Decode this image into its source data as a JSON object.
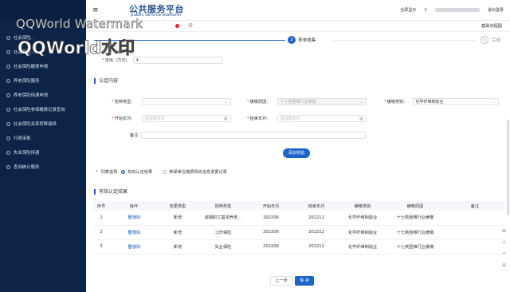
{
  "header": {
    "title": "公共服务平台",
    "subtitle": "public service platform",
    "links": [
      "全屏显示",
      "退出登录"
    ]
  },
  "tabbar": {
    "right_label": "基础流程图"
  },
  "steps": [
    {
      "number": "2",
      "label": "表单收集",
      "state": "active"
    },
    {
      "number": "3",
      "label": "完成",
      "state": "pending"
    }
  ],
  "sidebar": {
    "items": [
      {
        "label": "社会保险..."
      },
      {
        "label": "社会保险..."
      },
      {
        "label": "社会保险缴费申报"
      },
      {
        "label": "养老保险服务"
      },
      {
        "label": "养老保险待遇申领"
      },
      {
        "label": "社会保险参保缴费记录查询"
      },
      {
        "label": "社会保险关系转移接续"
      },
      {
        "label": "行政审批"
      },
      {
        "label": "失业保险待遇"
      },
      {
        "label": "查询统计服务"
      }
    ]
  },
  "form_top": {
    "label": "支出（万元）",
    "value": "4"
  },
  "recognition": {
    "title": "认定内容",
    "insurance_type_label": "险种类型:",
    "difficulty_reason_label": "缓缴原因:",
    "difficulty_reason_value": "十七类困难行业缓缴",
    "deferral_category_label": "缓缴类别:",
    "deferral_category_value": "化学纤维制造业",
    "start_month_label": "开始年月:",
    "start_month_placeholder": "请选择年月",
    "end_month_label": "结束年月:",
    "end_month_placeholder": "请选择年月",
    "remark_label": "备注:",
    "add_button": "添加校验"
  },
  "list_select": {
    "label": "列表选择:",
    "option1": "有效认定结果",
    "option2": "参保单位缴费相关信息变更记录"
  },
  "results": {
    "title": "有效认定结果",
    "columns": [
      "序号",
      "操作",
      "变更类型",
      "险种类型",
      "开始年月",
      "结束年月",
      "缓缴类别",
      "缓缴原因",
      "备注"
    ],
    "delete_label": "删除",
    "rows": [
      {
        "no": "1",
        "change": "新增",
        "insurance": "城镇职工基本养老...",
        "start": "202206",
        "end": "202212",
        "category": "化学纤维制造业",
        "reason": "十七类困难行业缓缴",
        "remark": ""
      },
      {
        "no": "2",
        "change": "新增",
        "insurance": "工伤保险",
        "start": "202206",
        "end": "202212",
        "category": "化学纤维制造业",
        "reason": "十七类困难行业缓缴",
        "remark": ""
      },
      {
        "no": "3",
        "change": "新增",
        "insurance": "失业保险",
        "start": "202206",
        "end": "202212",
        "category": "化学纤维制造业",
        "reason": "十七类困难行业缓缴",
        "remark": ""
      }
    ]
  },
  "footer": {
    "prev_label": "上一步",
    "save_label": "保 存"
  },
  "watermark": {
    "line1": "QQWorld Watermark",
    "line2": "QQWorld水印"
  },
  "colors": {
    "primary": "#1e63c6",
    "sidebar": "#0b2447",
    "required": "#e0242e"
  }
}
